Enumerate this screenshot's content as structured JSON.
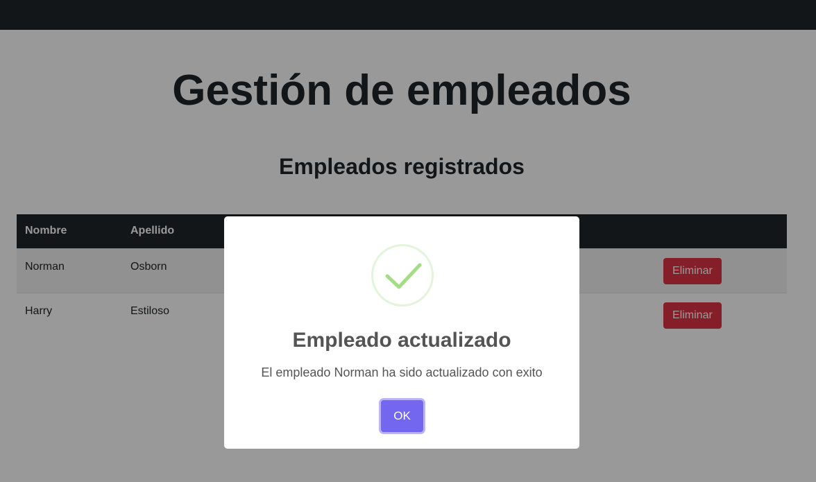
{
  "page": {
    "title": "Gestión de empleados",
    "section_title": "Empleados registrados"
  },
  "table": {
    "headers": [
      "Nombre",
      "Apellido"
    ],
    "rows": [
      {
        "nombre": "Norman",
        "apellido": "Osborn",
        "delete_label": "Eliminar"
      },
      {
        "nombre": "Harry",
        "apellido": "Estiloso",
        "delete_label": "Eliminar"
      }
    ]
  },
  "modal": {
    "icon": "success-check-icon",
    "title": "Empleado actualizado",
    "text": "El empleado Norman ha sido actualizado con exito",
    "confirm_label": "OK"
  },
  "colors": {
    "navbar": "#212529",
    "danger": "#dc3545",
    "confirm": "#7367f0",
    "success": "#a5dc86"
  }
}
